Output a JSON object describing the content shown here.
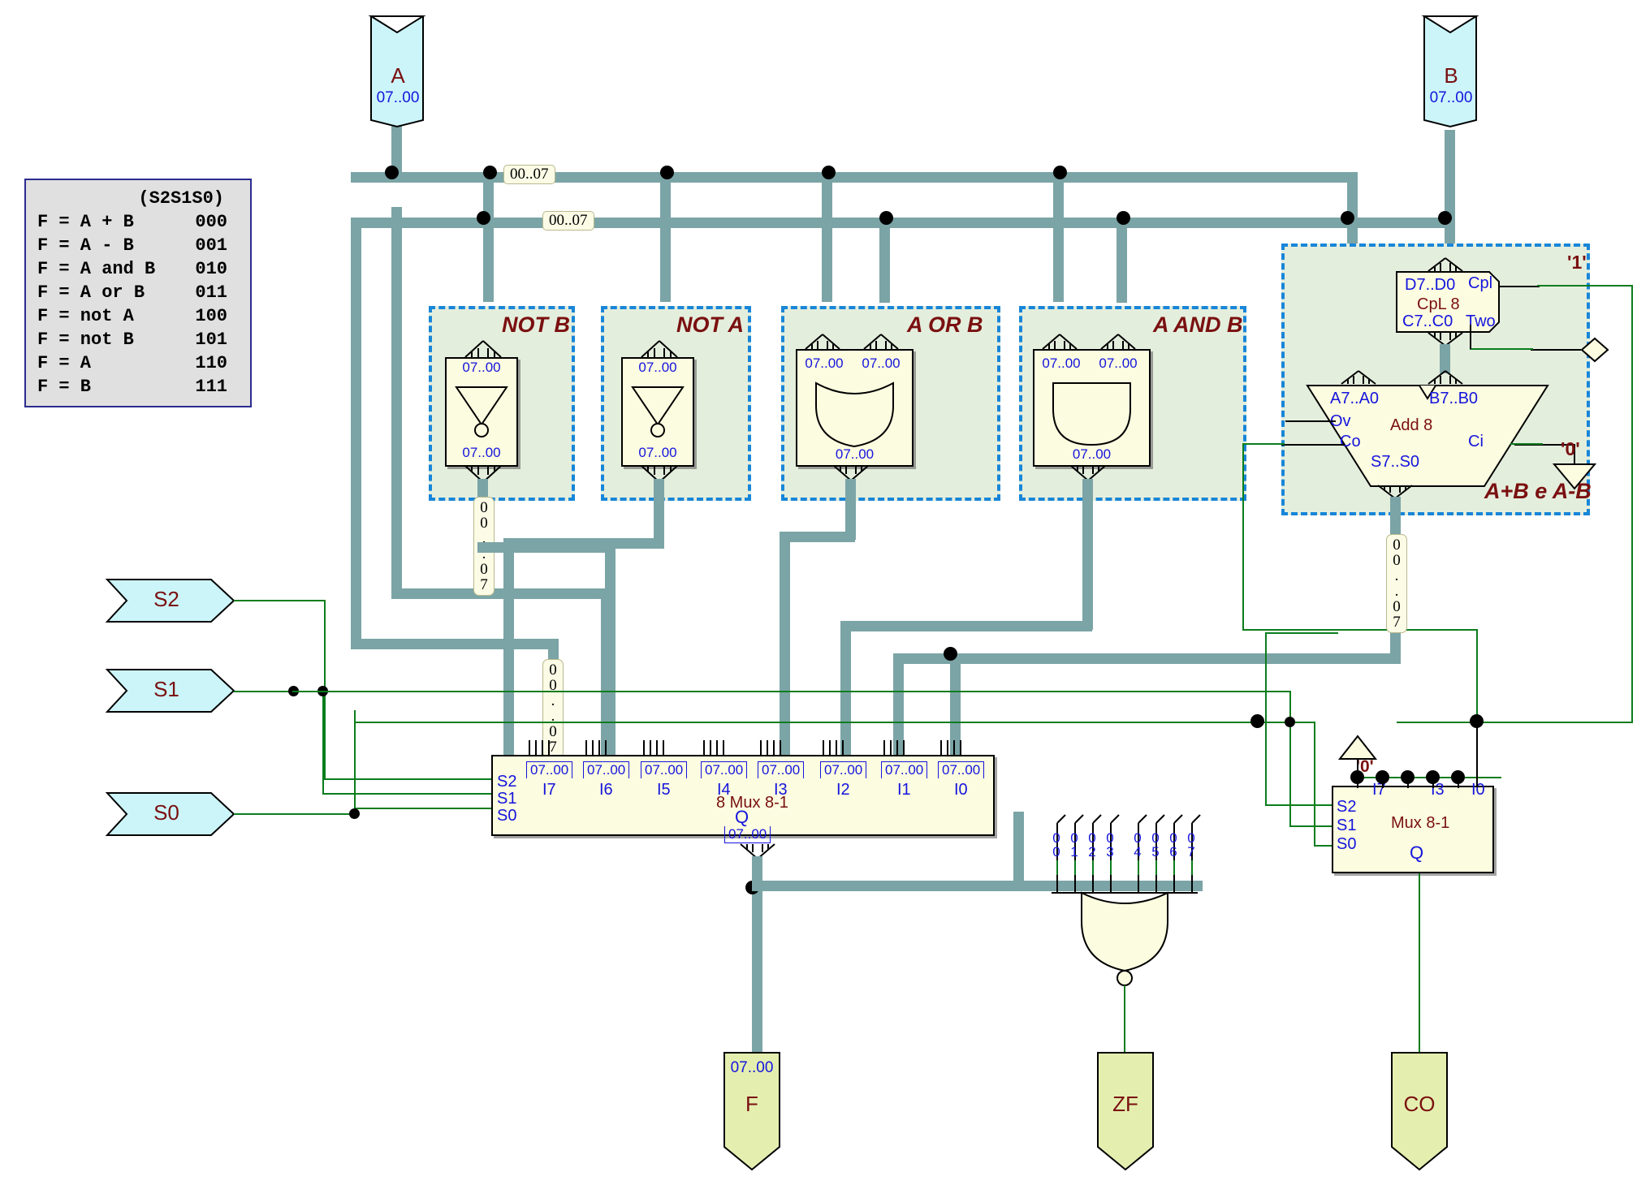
{
  "legend": {
    "header": "(S2S1S0)",
    "rows": [
      {
        "expr": "F = A + B",
        "code": "000"
      },
      {
        "expr": "F = A - B",
        "code": "001"
      },
      {
        "expr": "F = A and B",
        "code": "010"
      },
      {
        "expr": "F = A or B",
        "code": "011"
      },
      {
        "expr": "F = not A",
        "code": "100"
      },
      {
        "expr": "F = not B",
        "code": "101"
      },
      {
        "expr": "F = A",
        "code": "110"
      },
      {
        "expr": "F = B",
        "code": "111"
      }
    ]
  },
  "inputs": {
    "a": {
      "label": "A",
      "bits": "07..00"
    },
    "b": {
      "label": "B",
      "bits": "07..00"
    },
    "s2": {
      "label": "S2"
    },
    "s1": {
      "label": "S1"
    },
    "s0": {
      "label": "S0"
    }
  },
  "outputs": {
    "f": {
      "label": "F",
      "bits": "07..00"
    },
    "zf": {
      "label": "ZF"
    },
    "co": {
      "label": "CO"
    }
  },
  "bus_labels": {
    "top_a": "00..07",
    "top_b": "00..07",
    "notb_out": "00..07",
    "nota_out": "00..07",
    "add_out": "00..07"
  },
  "groups": {
    "not_b": {
      "title": "NOT B",
      "in_bits": "07..00",
      "out_bits": "07..00"
    },
    "not_a": {
      "title": "NOT A",
      "in_bits": "07..00",
      "out_bits": "07..00"
    },
    "a_or_b": {
      "title": "A OR B",
      "in_bits_1": "07..00",
      "in_bits_2": "07..00",
      "out_bits": "07..00"
    },
    "a_and_b": {
      "title": "A AND B",
      "in_bits_1": "07..00",
      "in_bits_2": "07..00",
      "out_bits": "07..00"
    },
    "adder": {
      "title": "A+B e A-B"
    }
  },
  "cpl": {
    "name": "CpL 8",
    "in_bits": "D7..D0",
    "out_bits": "C7..C0",
    "two": "Two",
    "cpl_pin": "Cpl",
    "const_one": "'1'"
  },
  "adder": {
    "name": "Add 8",
    "a_in": "A7..A0",
    "b_in": "B7..B0",
    "sum": "S7..S0",
    "ov": "Ov",
    "co": "Co",
    "ci": "Ci",
    "const_zero": "'0'"
  },
  "mux_main": {
    "name": "8 Mux 8-1",
    "sel": [
      "S2",
      "S1",
      "S0"
    ],
    "q_label": "Q",
    "q_bits": "07..00",
    "inputs": [
      {
        "label": "I7",
        "bits": "07..00"
      },
      {
        "label": "I6",
        "bits": "07..00"
      },
      {
        "label": "I5",
        "bits": "07..00"
      },
      {
        "label": "I4",
        "bits": "07..00"
      },
      {
        "label": "I3",
        "bits": "07..00"
      },
      {
        "label": "I2",
        "bits": "07..00"
      },
      {
        "label": "I1",
        "bits": "07..00"
      },
      {
        "label": "I0",
        "bits": "07..00"
      }
    ]
  },
  "mux_co": {
    "name": "Mux 8-1",
    "sel": [
      "S2",
      "S1",
      "S0"
    ],
    "q_label": "Q",
    "inputs": [
      "I7",
      "I3",
      "I0"
    ],
    "const_zero": "'0'"
  },
  "zf": {
    "bit_labels": [
      "00",
      "01",
      "02",
      "03",
      "04",
      "05",
      "06",
      "07"
    ],
    "gate": "nor"
  },
  "colors": {
    "bus": "#7ba4a6",
    "wire_green": "#0b7d1d",
    "group_border": "#1886d8",
    "group_fill": "#e4eedd",
    "pin_in_fill": "#ccf5fa",
    "pin_out_fill": "#e4efaf",
    "comp_fill": "#fcfce0",
    "pin_text": "#1515dd",
    "title_text": "#7a1010",
    "legend_fill": "#e0e0e0",
    "legend_border": "#2b2b8f"
  }
}
